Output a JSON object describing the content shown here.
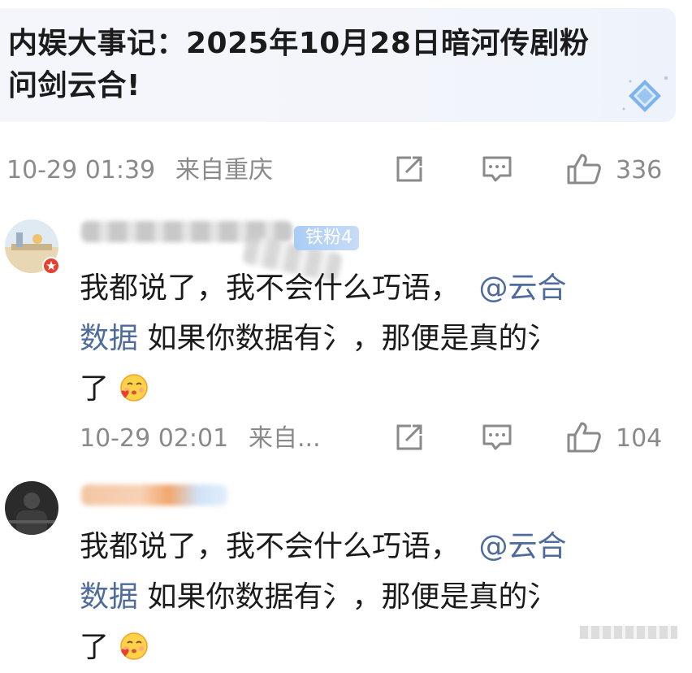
{
  "post": {
    "quote_line1": "内娱大事记：2025年10月28日暗河传剧粉",
    "quote_line2": "问剑云合!",
    "time": "10-29 01:39",
    "location": "来自重庆",
    "like_count": "336"
  },
  "comments": [
    {
      "fan_badge": "铁粉4",
      "text_part1": "我都说了，我不会什么巧语，",
      "mention": "@云合数据",
      "mention_line1": "@云合",
      "mention_line2": "数据",
      "text_part2": " 如果你数据有氵，那便是真的氵",
      "text_line2_rest": " 如果你数据有氵，那便是真的氵",
      "text_part3": "了",
      "time": "10-29 02:01",
      "location": "来自...",
      "like_count": "104"
    },
    {
      "text_part1": "我都说了，我不会什么巧语，",
      "mention_line1": "@云合",
      "mention_line2": "数据",
      "text_line2_rest": " 如果你数据有氵，那便是真的氵",
      "text_part3": "了"
    }
  ],
  "icons": {
    "share": "share-icon",
    "comment": "comment-icon",
    "like": "like-icon",
    "emoji": "smiling-emoji-icon"
  },
  "colors": {
    "meta_gray": "#8a8a8a",
    "mention_blue": "#4e6b9c",
    "fan_badge": "#a9ccf5"
  }
}
